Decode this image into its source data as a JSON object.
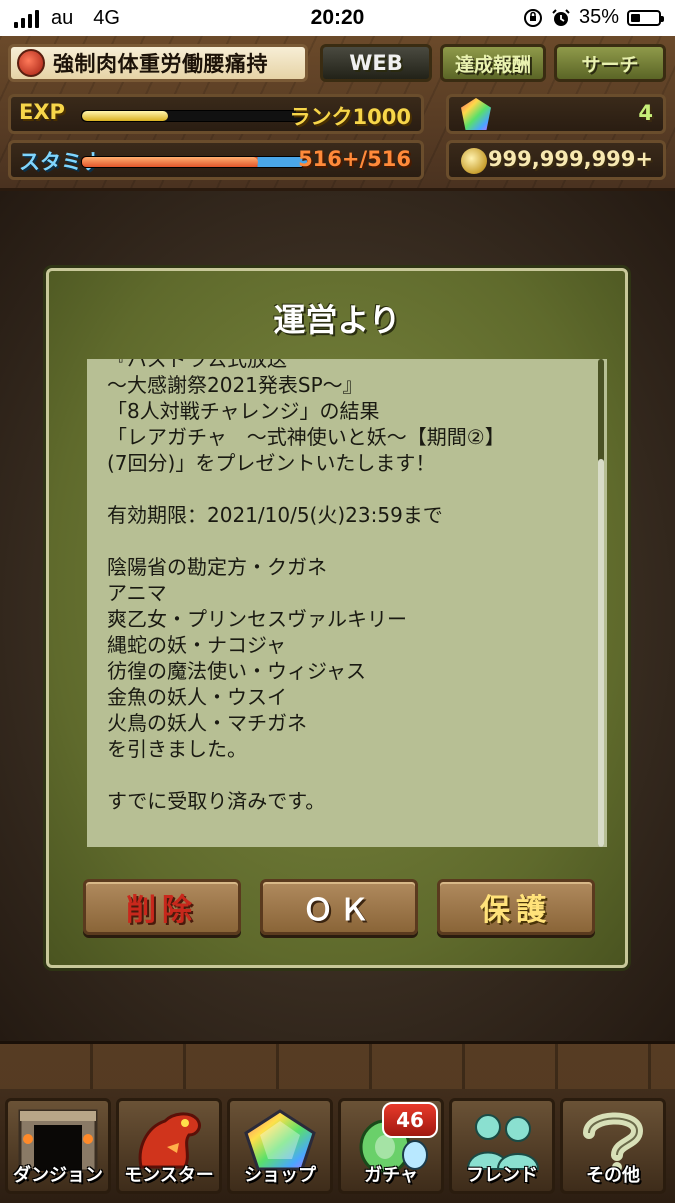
{
  "status_bar": {
    "carrier": "au",
    "network": "4G",
    "time": "20:20",
    "battery": "35%",
    "battery_level": 0.35
  },
  "header": {
    "player_name": "強制肉体重労働腰痛持",
    "web_label": "WEB",
    "achievements_label": "達成報酬",
    "search_label": "サーチ",
    "exp_label": "EXP",
    "exp_fraction": 0.38,
    "rank_text": "ランク1000",
    "stamina_label": "スタミナ",
    "stamina_value": "516+/516",
    "stamina_fraction": 1.0,
    "magic_stones": "4",
    "coins": "999,999,999+"
  },
  "dialog": {
    "title": "運営より",
    "message": "『パズドラ公式放送\n～大感謝祭2021発表SP～』\n「8人対戦チャレンジ」の結果\n「レアガチャ　～式神使いと妖～【期間②】\n(7回分)」をプレゼントいたします！\n\n有効期限：2021/10/5(火)23:59まで\n\n陰陽省の勘定方・クガネ\nアニマ\n爽乙女・プリンセスヴァルキリー\n縄蛇の妖・ナコジャ\n彷徨の魔法使い・ウィジャス\n金魚の妖人・ウスイ\n火鳥の妖人・マチガネ\nを引きました。\n\nすでに受取り済みです。",
    "delete_label": "削除",
    "ok_label": "ＯＫ",
    "protect_label": "保護"
  },
  "nav": {
    "dungeon": "ダンジョン",
    "monster": "モンスター",
    "shop": "ショップ",
    "gacha": "ガチャ",
    "gacha_badge": "46",
    "friend": "フレンド",
    "other": "その他"
  },
  "colors": {
    "dialog_bg": "#6f7a36",
    "message_bg": "#b7bf94",
    "delete_text": "#c8281c",
    "protect_text": "#ffe27a"
  }
}
